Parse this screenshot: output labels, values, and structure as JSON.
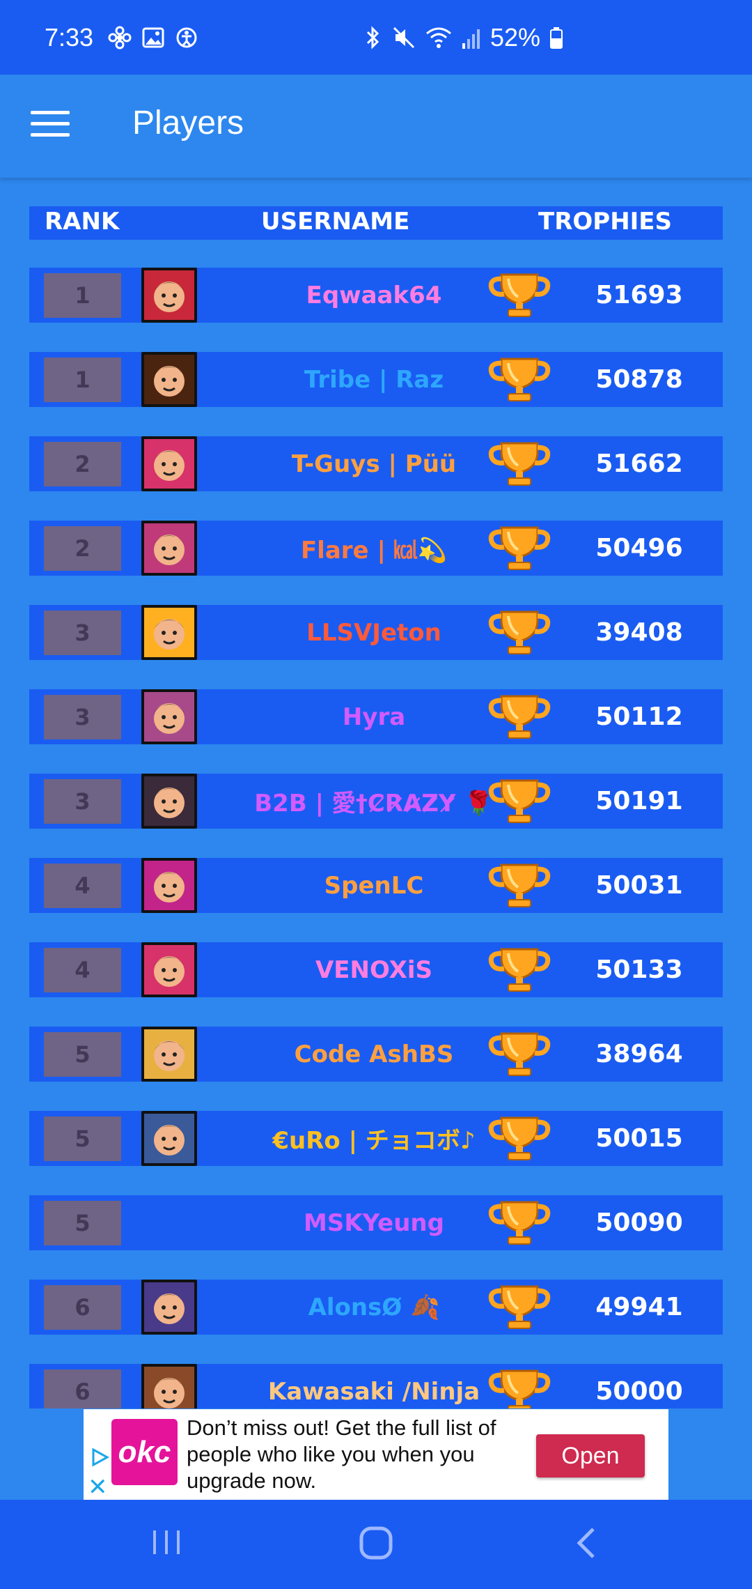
{
  "status_bar": {
    "time": "7:33",
    "battery": "52%",
    "icons": [
      "pinwheel-icon",
      "image-icon",
      "accessibility-icon",
      "bluetooth-icon",
      "mute-icon",
      "wifi-icon",
      "signal-icon",
      "battery-icon"
    ]
  },
  "app_bar": {
    "title": "Players",
    "menu_icon": "hamburger-menu-icon"
  },
  "table": {
    "headers": {
      "rank": "RANK",
      "username": "USERNAME",
      "trophies": "TROPHIES"
    },
    "rows": [
      {
        "rank": "1",
        "username": "Eqwaak64",
        "trophies": "51693",
        "name_color": "#ff7de0",
        "avatar_bg": "#c8283a",
        "has_avatar": true
      },
      {
        "rank": "1",
        "username": "Tribe | Raz",
        "trophies": "50878",
        "name_color": "#2ea7ff",
        "avatar_bg": "#4b2410",
        "has_avatar": true
      },
      {
        "rank": "2",
        "username": "T-Guys | Püü",
        "trophies": "51662",
        "name_color": "#ffa040",
        "avatar_bg": "#d8326a",
        "has_avatar": true
      },
      {
        "rank": "2",
        "username": "Flare | ㎉💫",
        "trophies": "50496",
        "name_color": "#ff7a40",
        "avatar_bg": "#c03a7a",
        "has_avatar": true
      },
      {
        "rank": "3",
        "username": "LLSVJeton",
        "trophies": "39408",
        "name_color": "#ff5a3a",
        "avatar_bg": "#ffb020",
        "has_avatar": true
      },
      {
        "rank": "3",
        "username": "Hyra",
        "trophies": "50112",
        "name_color": "#d25cff",
        "avatar_bg": "#a84a8a",
        "has_avatar": true
      },
      {
        "rank": "3",
        "username": "B2B | 愛†C̷R̷A̷Z̷Y̷ 🌹",
        "trophies": "50191",
        "name_color": "#d25cff",
        "avatar_bg": "#3a2a3a",
        "has_avatar": true
      },
      {
        "rank": "4",
        "username": "SpenLC",
        "trophies": "50031",
        "name_color": "#ffa040",
        "avatar_bg": "#c2248a",
        "has_avatar": true
      },
      {
        "rank": "4",
        "username": "VENOXiS",
        "trophies": "50133",
        "name_color": "#ff7de0",
        "avatar_bg": "#d8326a",
        "has_avatar": true
      },
      {
        "rank": "5",
        "username": "Code AshBS",
        "trophies": "38964",
        "name_color": "#ffa040",
        "avatar_bg": "#e8b040",
        "has_avatar": true
      },
      {
        "rank": "5",
        "username": "€uRo | チョコボ♪",
        "trophies": "50015",
        "name_color": "#ffc020",
        "avatar_bg": "#3a5a9a",
        "has_avatar": true
      },
      {
        "rank": "5",
        "username": "MSKYeung",
        "trophies": "50090",
        "name_color": "#d25cff",
        "avatar_bg": "#1a5cf2",
        "has_avatar": false
      },
      {
        "rank": "6",
        "username": "AlonsØ 🍂",
        "trophies": "49941",
        "name_color": "#2ea7ff",
        "avatar_bg": "#4a3a8a",
        "has_avatar": true
      },
      {
        "rank": "6",
        "username": "Kawasaki /Ninja",
        "trophies": "50000",
        "name_color": "#ffc880",
        "avatar_bg": "#8a4a2a",
        "has_avatar": true
      }
    ]
  },
  "ad": {
    "logo": "okc",
    "text": "Don’t miss out! Get the full list of people who like you when you upgrade now.",
    "button": "Open",
    "close": "✕"
  },
  "nav": {
    "recents": "recents-icon",
    "home": "home-icon",
    "back": "back-icon"
  },
  "colors": {
    "status_bar": "#1a5cf2",
    "app_bar": "#2d87ee",
    "row": "#1a5cf2",
    "rank_box": "#6f6386",
    "trophy": "#ffa51f"
  }
}
